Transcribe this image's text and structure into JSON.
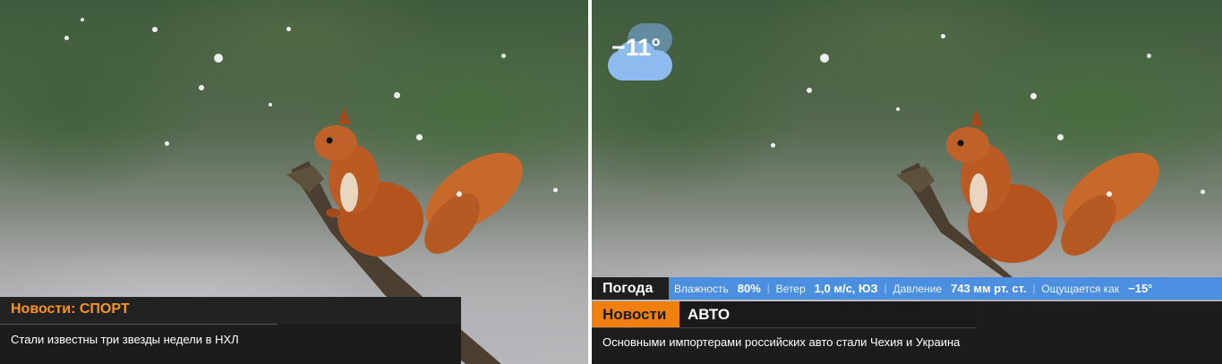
{
  "left_panel": {
    "news_bar": {
      "heading": "Новости:",
      "category": "СПОРТ",
      "headline": "Стали известны три звезды недели в НХЛ"
    }
  },
  "right_panel": {
    "weather_widget": {
      "temperature": "−11°",
      "icon": "cloud-icon"
    },
    "weather_bar": {
      "label": "Погода",
      "humidity_label": "Влажность",
      "humidity_value": "80%",
      "wind_label": "Ветер",
      "wind_value": "1,0 м/с, ЮЗ",
      "pressure_label": "Давление",
      "pressure_value": "743 мм рт. ст.",
      "feels_label": "Ощущается как",
      "feels_value": "−15°"
    },
    "news_bar": {
      "label": "Новости",
      "category": "АВТО",
      "headline": "Основными импортерами российских авто стали Чехия и Украина"
    }
  },
  "colors": {
    "accent_orange": "#f07f0e",
    "weather_blue": "#4a8fe0",
    "bar_dark": "#1c1c1c"
  }
}
